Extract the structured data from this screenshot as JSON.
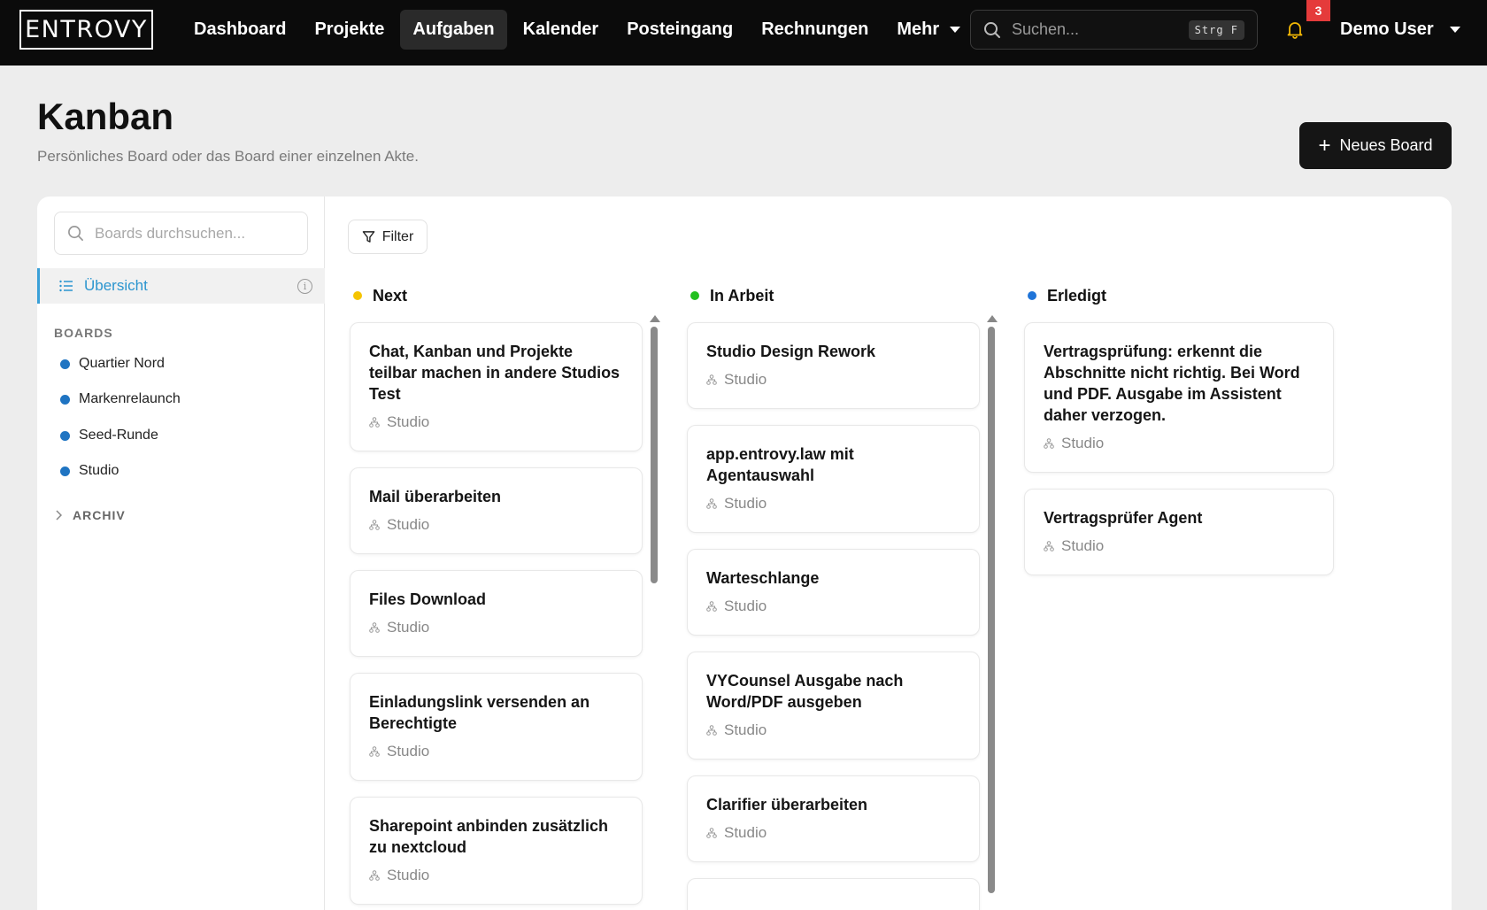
{
  "topbar": {
    "logo": "ENTROVY",
    "nav": [
      {
        "label": "Dashboard"
      },
      {
        "label": "Projekte"
      },
      {
        "label": "Aufgaben",
        "active": true
      },
      {
        "label": "Kalender"
      },
      {
        "label": "Posteingang"
      },
      {
        "label": "Rechnungen"
      },
      {
        "label": "Mehr"
      }
    ],
    "search_placeholder": "Suchen...",
    "search_shortcut": "Strg F",
    "notification_count": "3",
    "user_name": "Demo User"
  },
  "header": {
    "title": "Kanban",
    "subtitle": "Persönliches Board oder das Board einer einzelnen Akte.",
    "new_board_label": "Neues Board"
  },
  "sidebar": {
    "search_placeholder": "Boards durchsuchen...",
    "overview_label": "Übersicht",
    "boards_heading": "BOARDS",
    "boards": [
      {
        "label": "Quartier Nord"
      },
      {
        "label": "Markenrelaunch"
      },
      {
        "label": "Seed-Runde"
      },
      {
        "label": "Studio"
      }
    ],
    "archive_label": "ARCHIV"
  },
  "toolbar": {
    "filter_label": "Filter"
  },
  "columns": [
    {
      "title": "Next",
      "color": "#f5c400",
      "cards": [
        {
          "title": "Chat, Kanban und Projekte teilbar machen in andere Studios Test",
          "tag": "Studio"
        },
        {
          "title": "Mail überarbeiten",
          "tag": "Studio"
        },
        {
          "title": "Files Download",
          "tag": "Studio"
        },
        {
          "title": "Einladungslink versenden an Berechtigte",
          "tag": "Studio"
        },
        {
          "title": "Sharepoint anbinden zusätzlich zu nextcloud",
          "tag": "Studio"
        }
      ]
    },
    {
      "title": "In Arbeit",
      "color": "#22c01f",
      "cards": [
        {
          "title": "Studio Design Rework",
          "tag": "Studio"
        },
        {
          "title": "app.entrovy.law mit Agentauswahl",
          "tag": "Studio"
        },
        {
          "title": "Warteschlange",
          "tag": "Studio"
        },
        {
          "title": "VYCounsel Ausgabe nach Word/PDF ausgeben",
          "tag": "Studio"
        },
        {
          "title": "Clarifier überarbeiten",
          "tag": "Studio"
        }
      ]
    },
    {
      "title": "Erledigt",
      "color": "#1f74d8",
      "cards": [
        {
          "title": "Vertragsprüfung: erkennt die Abschnitte nicht richtig. Bei Word und PDF. Ausgabe im Assistent daher verzogen.",
          "tag": "Studio"
        },
        {
          "title": "Vertragsprüfer Agent",
          "tag": "Studio"
        }
      ]
    }
  ]
}
